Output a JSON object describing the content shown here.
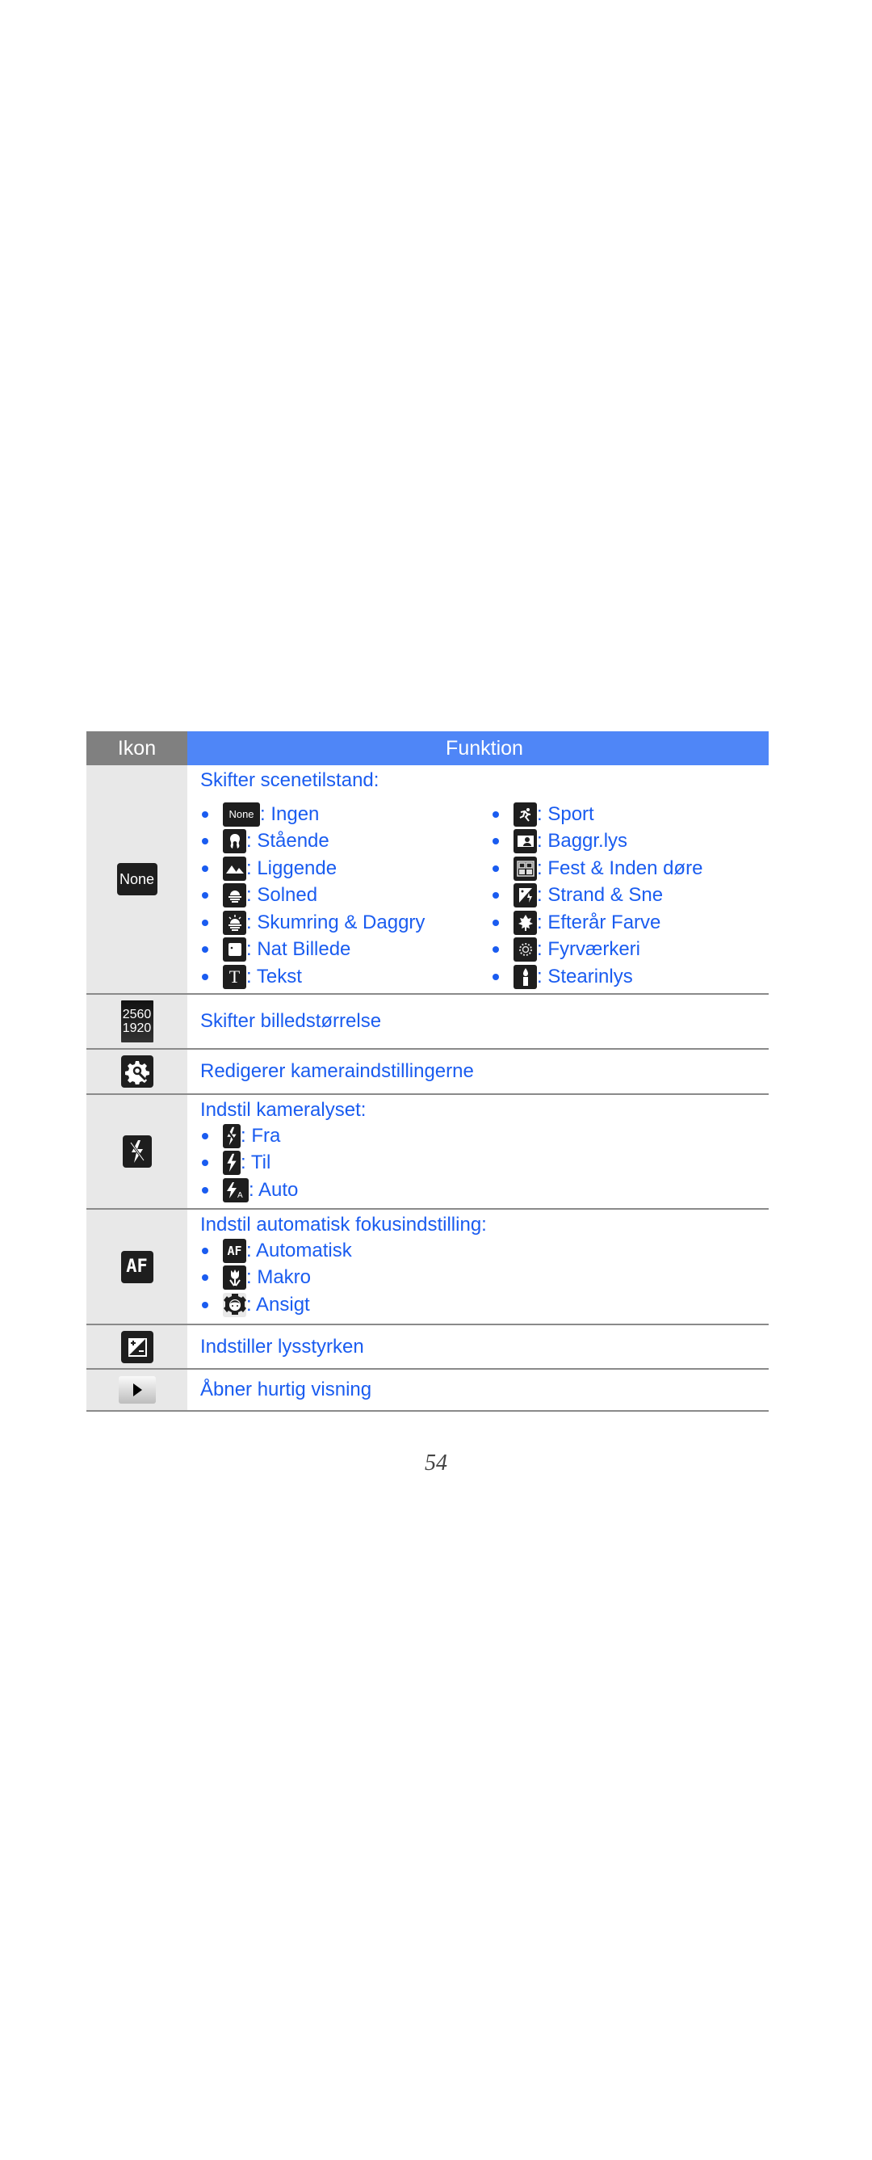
{
  "table": {
    "header": {
      "icon_col": "Ikon",
      "function_col": "Funktion"
    },
    "rows": [
      {
        "icon": "None",
        "icon_name": "scene-none-icon",
        "title": "Skifter scenetilstand:",
        "left_items": [
          {
            "icon": "None",
            "icon_name": "scene-none-icon",
            "label": ": Ingen"
          },
          {
            "icon": "portrait",
            "icon_name": "portrait-icon",
            "label": ": Stående"
          },
          {
            "icon": "landscape",
            "icon_name": "landscape-icon",
            "label": ": Liggende"
          },
          {
            "icon": "sunset",
            "icon_name": "sunset-icon",
            "label": ": Solned"
          },
          {
            "icon": "dawn",
            "icon_name": "dawn-icon",
            "label": ": Skumring & Daggry"
          },
          {
            "icon": "night",
            "icon_name": "night-shot-icon",
            "label": ": Nat Billede"
          },
          {
            "icon": "T",
            "icon_name": "text-icon",
            "label": ": Tekst"
          }
        ],
        "right_items": [
          {
            "icon": "sport",
            "icon_name": "sport-icon",
            "label": ": Sport"
          },
          {
            "icon": "backlight",
            "icon_name": "backlight-icon",
            "label": ": Baggr.lys"
          },
          {
            "icon": "party",
            "icon_name": "party-indoor-icon",
            "label": ": Fest & Inden døre"
          },
          {
            "icon": "beach",
            "icon_name": "beach-snow-icon",
            "label": ": Strand & Sne"
          },
          {
            "icon": "fall",
            "icon_name": "fall-color-icon",
            "label": ": Efterår Farve"
          },
          {
            "icon": "fireworks",
            "icon_name": "fireworks-icon",
            "label": ": Fyrværkeri"
          },
          {
            "icon": "candle",
            "icon_name": "candlelight-icon",
            "label": ": Stearinlys"
          }
        ]
      },
      {
        "icon_top": "2560",
        "icon_bottom": "1920",
        "icon_name": "resolution-icon",
        "title": "Skifter billedstørrelse"
      },
      {
        "icon_name": "settings-gear-icon",
        "title": "Redigerer kameraindstillingerne"
      },
      {
        "icon_name": "flash-off-icon",
        "title": "Indstil kameralyset:",
        "items": [
          {
            "icon_name": "flash-off-icon",
            "label": ": Fra"
          },
          {
            "icon_name": "flash-on-icon",
            "label": ": Til"
          },
          {
            "icon_name": "flash-auto-icon",
            "label": ": Auto"
          }
        ]
      },
      {
        "icon": "AF",
        "icon_name": "autofocus-icon",
        "title": "Indstil automatisk fokusindstilling:",
        "items": [
          {
            "icon": "AF",
            "icon_name": "autofocus-icon",
            "label": ": Automatisk"
          },
          {
            "icon_name": "macro-icon",
            "label": ": Makro"
          },
          {
            "icon_name": "face-detect-icon",
            "label": ": Ansigt"
          }
        ]
      },
      {
        "icon_name": "exposure-icon",
        "title": "Indstiller lysstyrken"
      },
      {
        "icon_name": "play-icon",
        "title": "Åbner hurtig visning"
      }
    ]
  },
  "page_number": "54",
  "colors": {
    "header_icon_bg": "#808080",
    "header_fn_bg": "#4f86f7",
    "text_blue": "#1a5cf0",
    "icon_col_bg": "#e8e8e8"
  }
}
